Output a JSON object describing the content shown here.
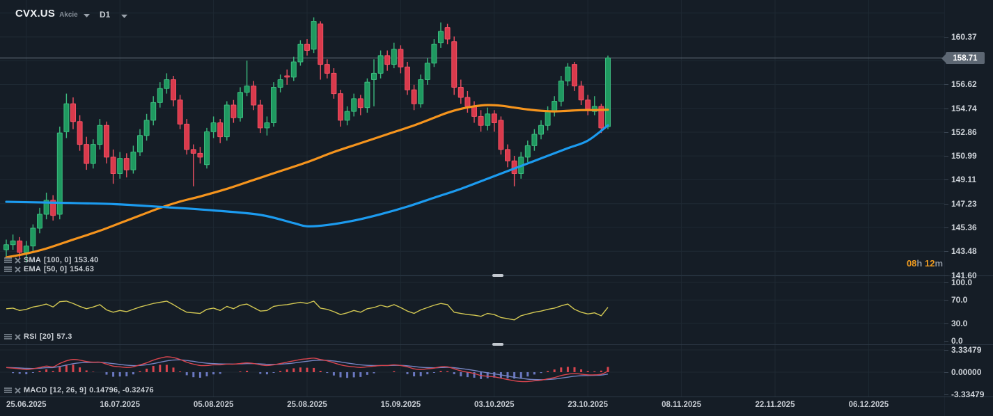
{
  "header": {
    "symbol": "CVX.US",
    "market_label": "Akcie",
    "timeframe": "D1"
  },
  "countdown": {
    "hours": "08",
    "hours_unit": "h ",
    "minutes": "12",
    "minutes_unit": "m"
  },
  "indicators": {
    "sma": {
      "name": "SMA",
      "params": "[100, 0]",
      "value": "153.40"
    },
    "ema": {
      "name": "EMA",
      "params": "[50, 0]",
      "value": "154.63"
    },
    "rsi": {
      "name": "RSI",
      "params": "[20]",
      "value": "57.3"
    },
    "macd": {
      "name": "MACD",
      "params": "[12, 26, 9]",
      "value": "0.14796, -0.32476"
    }
  },
  "colors": {
    "background": "#151d26",
    "grid": "#1e2933",
    "divider": "#2c3845",
    "bull_fill": "#1f9960",
    "bull_border": "#3cba7e",
    "bear_fill": "#d93a4c",
    "bear_border": "#ef5163",
    "sma_line": "#1c9bef",
    "ema_line": "#f5941d",
    "rsi_line": "#d3c853",
    "macd_line": "#d9454e",
    "macd_signal": "#7584c2",
    "hist_positive": "#d9454e",
    "hist_negative": "#6a78c0",
    "price_line": "#76828e",
    "price_tag_bg": "#5d6773",
    "countdown_orange": "#ee9b20"
  },
  "chart_data": {
    "type": "candlestick",
    "symbol": "CVX.US",
    "timeframe": "D1",
    "price_axis": {
      "labels": [
        "160.37",
        "156.62",
        "154.74",
        "152.86",
        "150.99",
        "149.11",
        "147.23",
        "145.36",
        "143.48",
        "141.60"
      ],
      "grid_levels": [
        162.25,
        160.37,
        158.49,
        156.62,
        154.74,
        152.86,
        150.99,
        149.11,
        147.23,
        145.36,
        143.48,
        141.6
      ],
      "current_price": "158.71"
    },
    "x_axis": {
      "labels": [
        {
          "text": "25.06.2025",
          "index": 3
        },
        {
          "text": "16.07.2025",
          "index": 17
        },
        {
          "text": "05.08.2025",
          "index": 31
        },
        {
          "text": "25.08.2025",
          "index": 45
        },
        {
          "text": "15.09.2025",
          "index": 59
        },
        {
          "text": "03.10.2025",
          "index": 73
        },
        {
          "text": "23.10.2025",
          "index": 87
        },
        {
          "text": "08.11.2025",
          "index": 101
        },
        {
          "text": "22.11.2025",
          "index": 115
        },
        {
          "text": "06.12.2025",
          "index": 129
        }
      ]
    },
    "candles": [
      [
        143.6,
        144.4,
        143.1,
        144.0
      ],
      [
        144.0,
        144.8,
        143.6,
        144.3
      ],
      [
        144.3,
        144.6,
        142.9,
        143.4
      ],
      [
        143.4,
        144.3,
        142.6,
        143.9
      ],
      [
        143.9,
        145.6,
        143.5,
        145.3
      ],
      [
        145.3,
        146.9,
        144.9,
        146.4
      ],
      [
        146.4,
        148.1,
        146.0,
        147.5
      ],
      [
        147.5,
        147.9,
        145.9,
        146.3
      ],
      [
        146.4,
        153.3,
        146.0,
        152.8
      ],
      [
        152.9,
        155.9,
        152.4,
        155.1
      ],
      [
        155.1,
        155.6,
        153.1,
        153.7
      ],
      [
        153.7,
        154.2,
        151.4,
        151.9
      ],
      [
        151.9,
        152.5,
        149.9,
        150.4
      ],
      [
        150.4,
        152.3,
        150.0,
        151.9
      ],
      [
        151.9,
        153.9,
        151.5,
        153.4
      ],
      [
        153.4,
        153.7,
        150.4,
        150.9
      ],
      [
        150.9,
        151.5,
        148.8,
        149.6
      ],
      [
        149.6,
        151.3,
        149.2,
        150.8
      ],
      [
        150.8,
        151.2,
        149.3,
        149.9
      ],
      [
        149.9,
        151.8,
        149.6,
        151.3
      ],
      [
        151.3,
        153.1,
        151.0,
        152.6
      ],
      [
        152.6,
        154.3,
        152.2,
        153.8
      ],
      [
        153.8,
        155.7,
        153.4,
        155.2
      ],
      [
        155.2,
        156.8,
        154.8,
        156.3
      ],
      [
        156.3,
        157.5,
        155.9,
        157.0
      ],
      [
        157.0,
        157.3,
        154.9,
        155.4
      ],
      [
        155.4,
        155.8,
        153.1,
        153.5
      ],
      [
        153.5,
        153.9,
        151.1,
        151.5
      ],
      [
        151.5,
        151.9,
        148.6,
        151.2
      ],
      [
        151.2,
        151.7,
        150.4,
        150.9
      ],
      [
        150.3,
        153.2,
        150.0,
        152.9
      ],
      [
        152.9,
        154.1,
        152.4,
        153.6
      ],
      [
        153.6,
        153.9,
        152.0,
        152.5
      ],
      [
        152.5,
        155.3,
        152.2,
        155.0
      ],
      [
        155.0,
        155.4,
        153.6,
        154.0
      ],
      [
        154.0,
        156.4,
        153.7,
        156.0
      ],
      [
        156.0,
        158.5,
        155.7,
        156.5
      ],
      [
        156.5,
        156.9,
        154.6,
        155.0
      ],
      [
        155.0,
        155.4,
        152.8,
        153.2
      ],
      [
        153.2,
        154.1,
        152.6,
        153.6
      ],
      [
        153.6,
        156.8,
        153.3,
        156.4
      ],
      [
        156.4,
        157.4,
        156.0,
        157.0
      ],
      [
        157.3,
        157.8,
        156.6,
        157.2
      ],
      [
        157.2,
        158.8,
        156.9,
        158.4
      ],
      [
        158.4,
        160.1,
        158.1,
        159.8
      ],
      [
        159.8,
        160.2,
        158.9,
        159.3
      ],
      [
        159.4,
        161.9,
        159.1,
        161.6
      ],
      [
        161.4,
        161.6,
        157.0,
        158.2
      ],
      [
        158.2,
        158.6,
        157.1,
        157.5
      ],
      [
        157.5,
        157.9,
        155.5,
        155.9
      ],
      [
        155.9,
        156.2,
        153.3,
        153.8
      ],
      [
        153.8,
        154.9,
        153.4,
        154.5
      ],
      [
        154.5,
        155.9,
        154.1,
        155.5
      ],
      [
        155.5,
        155.8,
        154.2,
        154.8
      ],
      [
        154.8,
        157.1,
        154.4,
        156.8
      ],
      [
        157.0,
        158.6,
        154.9,
        157.5
      ],
      [
        157.5,
        159.3,
        157.1,
        158.9
      ],
      [
        158.9,
        159.3,
        157.7,
        158.2
      ],
      [
        158.2,
        159.9,
        157.9,
        159.4
      ],
      [
        159.4,
        159.7,
        157.5,
        158.0
      ],
      [
        158.0,
        158.4,
        155.8,
        156.2
      ],
      [
        156.2,
        156.6,
        154.6,
        155.1
      ],
      [
        155.1,
        157.4,
        154.8,
        157.0
      ],
      [
        157.0,
        158.7,
        156.6,
        158.3
      ],
      [
        158.3,
        160.2,
        158.0,
        159.8
      ],
      [
        159.9,
        161.5,
        159.5,
        160.8
      ],
      [
        161.1,
        161.4,
        159.8,
        160.2
      ],
      [
        160.0,
        160.4,
        155.8,
        156.4
      ],
      [
        156.4,
        157.0,
        155.1,
        155.6
      ],
      [
        155.6,
        156.1,
        154.4,
        154.9
      ],
      [
        154.9,
        155.3,
        153.6,
        154.1
      ],
      [
        154.1,
        154.6,
        152.9,
        153.4
      ],
      [
        153.4,
        154.8,
        153.0,
        154.3
      ],
      [
        154.3,
        154.6,
        152.9,
        153.6
      ],
      [
        153.8,
        154.1,
        151.1,
        151.5
      ],
      [
        151.5,
        151.9,
        150.1,
        150.6
      ],
      [
        150.6,
        151.0,
        148.6,
        149.6
      ],
      [
        149.6,
        151.3,
        149.2,
        150.9
      ],
      [
        150.9,
        152.2,
        150.5,
        151.8
      ],
      [
        151.8,
        153.1,
        151.4,
        152.7
      ],
      [
        152.7,
        153.8,
        152.3,
        153.4
      ],
      [
        153.4,
        154.9,
        153.0,
        154.5
      ],
      [
        154.5,
        155.7,
        154.1,
        155.3
      ],
      [
        155.3,
        157.3,
        154.9,
        156.9
      ],
      [
        156.9,
        158.3,
        156.5,
        158.0
      ],
      [
        158.2,
        158.4,
        156.1,
        156.5
      ],
      [
        156.5,
        156.9,
        155.0,
        155.4
      ],
      [
        155.4,
        155.8,
        154.2,
        154.7
      ],
      [
        154.5,
        155.7,
        154.2,
        154.9
      ],
      [
        154.9,
        155.1,
        152.8,
        153.2
      ],
      [
        153.3,
        158.9,
        153.1,
        158.71
      ]
    ],
    "sma100": {
      "label": "SMA [100, 0]",
      "value": 153.4,
      "points": [
        [
          0,
          147.38
        ],
        [
          8,
          147.3
        ],
        [
          16,
          147.2
        ],
        [
          24,
          146.95
        ],
        [
          31,
          146.7
        ],
        [
          38,
          146.35
        ],
        [
          43,
          145.7
        ],
        [
          45,
          145.45
        ],
        [
          48,
          145.55
        ],
        [
          52,
          145.9
        ],
        [
          56,
          146.4
        ],
        [
          60,
          147.0
        ],
        [
          64,
          147.7
        ],
        [
          68,
          148.4
        ],
        [
          72,
          149.2
        ],
        [
          76,
          150.0
        ],
        [
          80,
          150.8
        ],
        [
          84,
          151.6
        ],
        [
          87,
          152.2
        ],
        [
          90,
          153.4
        ]
      ]
    },
    "ema50": {
      "label": "EMA [50, 0]",
      "value": 154.63,
      "points": [
        [
          0,
          143.0
        ],
        [
          3,
          143.3
        ],
        [
          6,
          143.7
        ],
        [
          10,
          144.4
        ],
        [
          14,
          145.1
        ],
        [
          17,
          145.7
        ],
        [
          20,
          146.3
        ],
        [
          23,
          146.9
        ],
        [
          26,
          147.4
        ],
        [
          29,
          147.8
        ],
        [
          33,
          148.4
        ],
        [
          37,
          149.1
        ],
        [
          41,
          149.8
        ],
        [
          45,
          150.5
        ],
        [
          49,
          151.3
        ],
        [
          53,
          152.0
        ],
        [
          57,
          152.7
        ],
        [
          61,
          153.4
        ],
        [
          64,
          154.0
        ],
        [
          66,
          154.4
        ],
        [
          68,
          154.7
        ],
        [
          70,
          154.9
        ],
        [
          72,
          155.0
        ],
        [
          74,
          154.95
        ],
        [
          76,
          154.8
        ],
        [
          78,
          154.65
        ],
        [
          80,
          154.55
        ],
        [
          82,
          154.5
        ],
        [
          84,
          154.55
        ],
        [
          86,
          154.6
        ],
        [
          88,
          154.6
        ],
        [
          90,
          154.63
        ]
      ]
    },
    "rsi": {
      "label": "RSI [20]",
      "value": 57.3,
      "levels": [
        "100.0",
        "70.0",
        "30.0",
        "0.0"
      ],
      "values": [
        55,
        56,
        52,
        54,
        58,
        60,
        63,
        58,
        67,
        68,
        64,
        59,
        55,
        58,
        62,
        53,
        49,
        52,
        50,
        54,
        58,
        61,
        64,
        66,
        68,
        62,
        55,
        49,
        48,
        47,
        54,
        56,
        52,
        59,
        55,
        61,
        63,
        57,
        51,
        52,
        59,
        61,
        62,
        64,
        66,
        64,
        68,
        56,
        54,
        50,
        45,
        48,
        52,
        49,
        55,
        57,
        61,
        58,
        62,
        57,
        51,
        47,
        53,
        57,
        61,
        64,
        62,
        49,
        47,
        45,
        44,
        42,
        47,
        45,
        40,
        38,
        36,
        43,
        46,
        49,
        51,
        54,
        56,
        60,
        63,
        54,
        49,
        46,
        48,
        43,
        57.3
      ]
    },
    "macd": {
      "label": "MACD [12, 26, 9]",
      "value_text": "0.14796, -0.32476",
      "axis_labels": [
        "3.33479",
        "0.00000",
        "-3.33479"
      ],
      "axis_values": [
        3.33479,
        0,
        -3.33479
      ],
      "values": [
        0.7,
        0.6,
        0.5,
        0.4,
        0.5,
        0.7,
        0.9,
        0.8,
        1.3,
        1.7,
        1.9,
        1.8,
        1.6,
        1.5,
        1.5,
        1.2,
        0.9,
        0.8,
        0.7,
        0.8,
        1.1,
        1.4,
        1.8,
        2.1,
        2.3,
        2.2,
        1.9,
        1.5,
        1.2,
        1.0,
        1.0,
        1.1,
        1.1,
        1.2,
        1.2,
        1.3,
        1.4,
        1.3,
        1.1,
        1.0,
        1.1,
        1.3,
        1.5,
        1.7,
        1.9,
        2.0,
        2.1,
        1.9,
        1.7,
        1.4,
        1.1,
        0.9,
        0.8,
        0.7,
        0.8,
        0.9,
        1.0,
        1.0,
        1.1,
        1.0,
        0.8,
        0.5,
        0.4,
        0.5,
        0.6,
        0.8,
        0.8,
        0.5,
        0.2,
        0.0,
        -0.2,
        -0.5,
        -0.6,
        -0.7,
        -0.9,
        -1.1,
        -1.3,
        -1.4,
        -1.4,
        -1.3,
        -1.2,
        -1.0,
        -0.8,
        -0.5,
        -0.3,
        -0.2,
        -0.3,
        -0.4,
        -0.4,
        -0.3,
        0.148
      ]
    }
  }
}
